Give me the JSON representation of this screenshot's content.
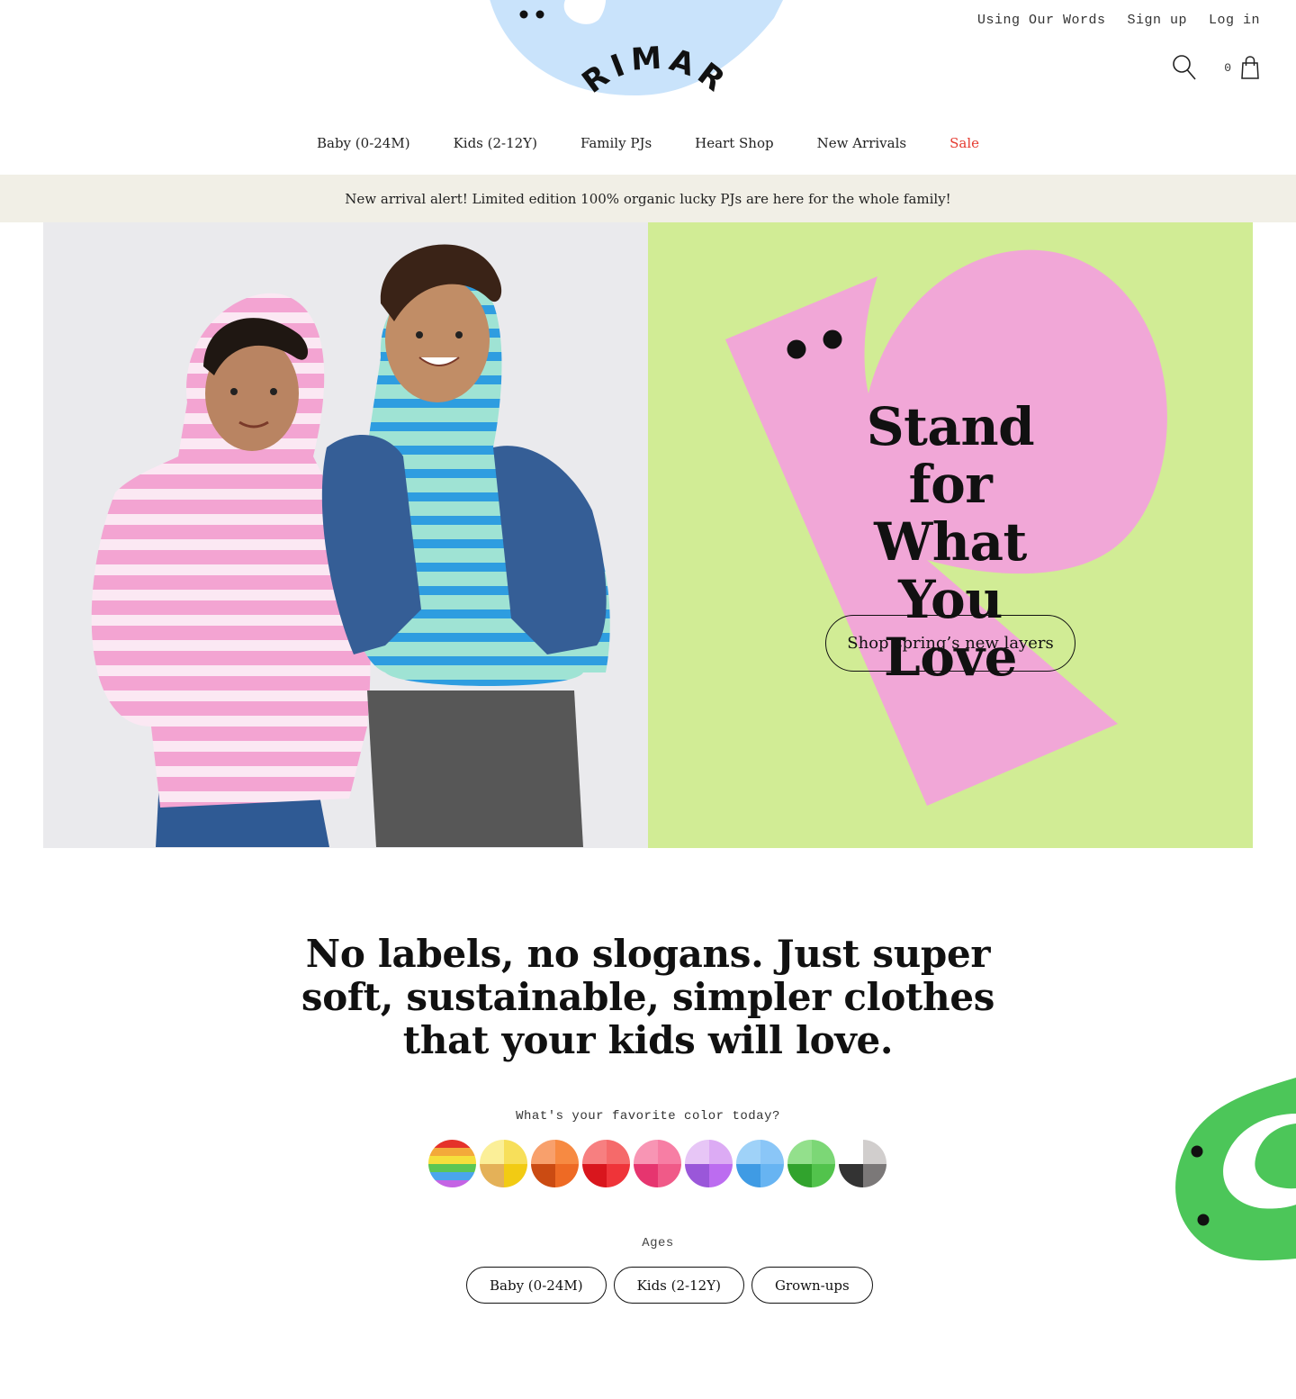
{
  "brand": {
    "logo_text": "PRIMARY"
  },
  "utility_links": {
    "using_our_words": "Using Our Words",
    "sign_up": "Sign up",
    "log_in": "Log in"
  },
  "cart": {
    "count": "0"
  },
  "nav": {
    "baby": "Baby (0-24M)",
    "kids": "Kids (2-12Y)",
    "family_pjs": "Family PJs",
    "heart_shop": "Heart Shop",
    "new_arrivals": "New Arrivals",
    "sale": "Sale"
  },
  "promo": {
    "text": "New arrival alert! Limited edition 100% organic lucky PJs are here for the whole family!"
  },
  "hero": {
    "heading_line1": "Stand for",
    "heading_line2": "What You",
    "heading_line3": "Love",
    "cta": "Shop spring’s new layers"
  },
  "intro": {
    "line1": "No labels, no slogans. Just super",
    "line2": "soft, sustainable, simpler clothes",
    "line3": "that your kids will love."
  },
  "color_picker": {
    "prompt": "What's your favorite color today?",
    "swatches": [
      "rainbow",
      "yellow",
      "orange",
      "red",
      "pink",
      "purple",
      "blue",
      "green",
      "gray"
    ]
  },
  "ages": {
    "label": "Ages",
    "baby": "Baby (0-24M)",
    "kids": "Kids (2-12Y)",
    "grownups": "Grown-ups"
  },
  "icons": {
    "search": "search-icon",
    "cart": "shopping-bag-icon"
  },
  "colors": {
    "sale": "#e53b30",
    "promo_bg": "#f1efe6",
    "hero_panel_bg": "#d1ec95",
    "hero_shape": "#f1a7d7",
    "logo_blob": "#c9e3fb",
    "green_blob": "#4cc659"
  }
}
